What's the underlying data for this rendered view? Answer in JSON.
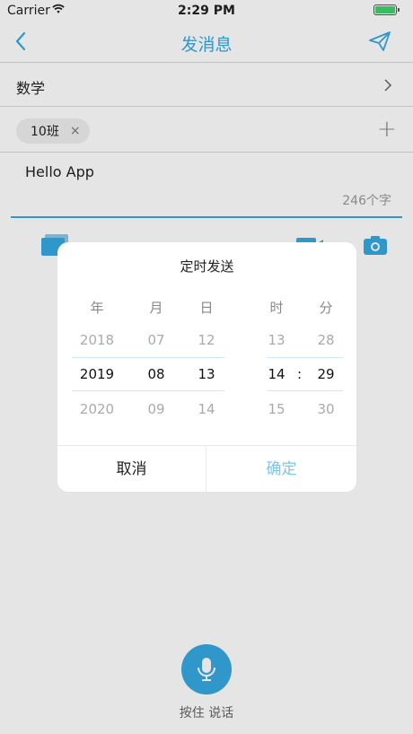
{
  "status_bar": {
    "carrier": "Carrier",
    "time": "2:29 PM",
    "battery_level": 1.0,
    "battery_color": "#3bd36b"
  },
  "nav": {
    "title": "发消息"
  },
  "subject": {
    "label": "数学"
  },
  "classes": {
    "chip_label": "10班",
    "remove_glyph": "×",
    "add_glyph": "+"
  },
  "message": {
    "text": "Hello App",
    "remaining": "246个字"
  },
  "accent_color": "#35a9e1",
  "picker": {
    "title": "定时发送",
    "headers": {
      "year": "年",
      "month": "月",
      "day": "日",
      "hour": "时",
      "minute": "分"
    },
    "year": {
      "prev": "2018",
      "selected": "2019",
      "next": "2020"
    },
    "month": {
      "prev": "07",
      "selected": "08",
      "next": "09"
    },
    "day": {
      "prev": "12",
      "selected": "13",
      "next": "14"
    },
    "hour": {
      "prev": "13",
      "selected": "14",
      "next": "15"
    },
    "minute": {
      "prev": "28",
      "selected": "29",
      "next": "30"
    },
    "separator": ":",
    "cancel_label": "取消",
    "confirm_label": "确定"
  },
  "voice": {
    "label": "按住 说话"
  }
}
